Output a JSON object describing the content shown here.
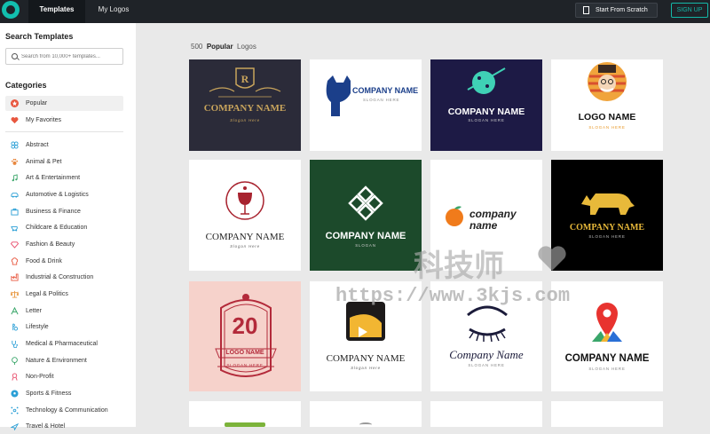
{
  "topbar": {
    "tab_templates": "Templates",
    "tab_mylogos": "My Logos",
    "btn_scratch": "Start From Scratch",
    "btn_signup": "SIGN UP"
  },
  "sidebar": {
    "title": "Search Templates",
    "search_placeholder": "Search from 10,000+ templates...",
    "categories_title": "Categories",
    "items": [
      {
        "label": "Popular",
        "icon": "star-icon"
      },
      {
        "label": "My Favorites",
        "icon": "heart-icon"
      },
      {
        "label": "Abstract",
        "icon": "abstract-icon"
      },
      {
        "label": "Animal & Pet",
        "icon": "paw-icon"
      },
      {
        "label": "Art & Entertainment",
        "icon": "music-note-icon"
      },
      {
        "label": "Automotive & Logistics",
        "icon": "car-icon"
      },
      {
        "label": "Business & Finance",
        "icon": "briefcase-icon"
      },
      {
        "label": "Childcare & Education",
        "icon": "stroller-icon"
      },
      {
        "label": "Fashion & Beauty",
        "icon": "diamond-icon"
      },
      {
        "label": "Food & Drink",
        "icon": "chef-hat-icon"
      },
      {
        "label": "Industrial & Construction",
        "icon": "factory-icon"
      },
      {
        "label": "Legal & Politics",
        "icon": "scales-icon"
      },
      {
        "label": "Letter",
        "icon": "letter-icon"
      },
      {
        "label": "Lifestyle",
        "icon": "lifestyle-icon"
      },
      {
        "label": "Medical & Pharmaceutical",
        "icon": "stethoscope-icon"
      },
      {
        "label": "Nature & Environment",
        "icon": "tree-icon"
      },
      {
        "label": "Non-Profit",
        "icon": "ribbon-icon"
      },
      {
        "label": "Sports & Fitness",
        "icon": "soccer-ball-icon"
      },
      {
        "label": "Technology & Communication",
        "icon": "network-icon"
      },
      {
        "label": "Travel & Hotel",
        "icon": "plane-icon"
      }
    ]
  },
  "main": {
    "count": "500",
    "popular": "Popular",
    "logos": "Logos",
    "cards": [
      {
        "name": "COMPANY NAME",
        "slogan": "Slogan Here",
        "bg": "#2b2b39"
      },
      {
        "name": "COMPANY NAME",
        "slogan": "SLOGAN HERE",
        "bg": "#ffffff"
      },
      {
        "name": "COMPANY NAME",
        "slogan": "SLOGAN HERE",
        "bg": "#1d1a45"
      },
      {
        "name": "LOGO NAME",
        "slogan": "SLOGAN HERE",
        "bg": "#ffffff"
      },
      {
        "name": "COMPANY NAME",
        "slogan": "Slogan Here",
        "bg": "#ffffff"
      },
      {
        "name": "COMPANY NAME",
        "slogan": "SLOGAN",
        "bg": "#1c4a2b"
      },
      {
        "name": "company",
        "name2": "name",
        "bg": "#ffffff"
      },
      {
        "name": "COMPANY NAME",
        "slogan": "SLOGAN HERE",
        "bg": "#000000"
      },
      {
        "badge": "20",
        "name": "LOGO NAME",
        "slogan": "SLOGAN HERE",
        "bg": "#f6d2cb"
      },
      {
        "name": "COMPANY NAME",
        "slogan": "Slogan Here",
        "bg": "#ffffff"
      },
      {
        "name": "Company Name",
        "slogan": "SLOGAN HERE",
        "bg": "#ffffff"
      },
      {
        "name": "COMPANY NAME",
        "slogan": "SLOGAN HERE",
        "bg": "#ffffff"
      }
    ]
  },
  "watermark": {
    "text": "科技师",
    "url": "https://www.3kjs.com"
  },
  "colors": {
    "accent": "#13b8a8",
    "topbar": "#1f2328"
  }
}
